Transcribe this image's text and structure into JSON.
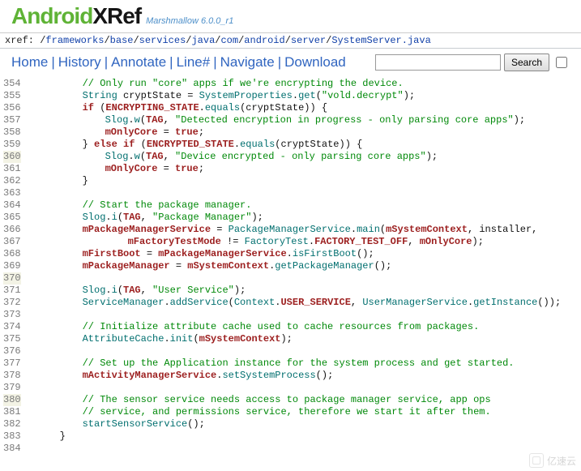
{
  "logo": {
    "a": "Android",
    "x": "XRef"
  },
  "version": "Marshmallow 6.0.0_r1",
  "path": {
    "prefix": "xref: ",
    "segs": [
      "frameworks",
      "base",
      "services",
      "java",
      "com",
      "android",
      "server",
      "SystemServer.java"
    ]
  },
  "nav": {
    "home": "Home",
    "history": "History",
    "annotate": "Annotate",
    "line": "Line#",
    "navigate": "Navigate",
    "download": "Download"
  },
  "search": {
    "placeholder": "",
    "button": "Search"
  },
  "lines": {
    "start": 354,
    "highlight": [
      360,
      370,
      380
    ]
  },
  "code": {
    "l354": "// Only run \"core\" apps if we're encrypting the device.",
    "l355_a": "String",
    "l355_b": " cryptState = ",
    "l355_c": "SystemProperties",
    "l355_d": ".",
    "l355_e": "get",
    "l355_f": "(",
    "l355_g": "\"vold.decrypt\"",
    "l355_h": ");",
    "l356_a": "if",
    "l356_b": " (",
    "l356_c": "ENCRYPTING_STATE",
    "l356_d": ".",
    "l356_e": "equals",
    "l356_f": "(cryptState)) {",
    "l357_a": "Slog",
    "l357_b": ".",
    "l357_c": "w",
    "l357_d": "(",
    "l357_e": "TAG",
    "l357_f": ", ",
    "l357_g": "\"Detected encryption in progress - only parsing core apps\"",
    "l357_h": ");",
    "l358_a": "mOnlyCore",
    "l358_b": " = ",
    "l358_c": "true",
    "l358_d": ";",
    "l359_a": "} ",
    "l359_b": "else if",
    "l359_c": " (",
    "l359_d": "ENCRYPTED_STATE",
    "l359_e": ".",
    "l359_f": "equals",
    "l359_g": "(cryptState)) {",
    "l360_a": "Slog",
    "l360_b": ".",
    "l360_c": "w",
    "l360_d": "(",
    "l360_e": "TAG",
    "l360_f": ", ",
    "l360_g": "\"Device encrypted - only parsing core apps\"",
    "l360_h": ");",
    "l361_a": "mOnlyCore",
    "l361_b": " = ",
    "l361_c": "true",
    "l361_d": ";",
    "l362": "}",
    "l363": "",
    "l364": "// Start the package manager.",
    "l365_a": "Slog",
    "l365_b": ".",
    "l365_c": "i",
    "l365_d": "(",
    "l365_e": "TAG",
    "l365_f": ", ",
    "l365_g": "\"Package Manager\"",
    "l365_h": ");",
    "l366_a": "mPackageManagerService",
    "l366_b": " = ",
    "l366_c": "PackageManagerService",
    "l366_d": ".",
    "l366_e": "main",
    "l366_f": "(",
    "l366_g": "mSystemContext",
    "l366_h": ", installer,",
    "l367_a": "mFactoryTestMode",
    "l367_b": " != ",
    "l367_c": "FactoryTest",
    "l367_d": ".",
    "l367_e": "FACTORY_TEST_OFF",
    "l367_f": ", ",
    "l367_g": "mOnlyCore",
    "l367_h": ");",
    "l368_a": "mFirstBoot",
    "l368_b": " = ",
    "l368_c": "mPackageManagerService",
    "l368_d": ".",
    "l368_e": "isFirstBoot",
    "l368_f": "();",
    "l369_a": "mPackageManager",
    "l369_b": " = ",
    "l369_c": "mSystemContext",
    "l369_d": ".",
    "l369_e": "getPackageManager",
    "l369_f": "();",
    "l370": "",
    "l371_a": "Slog",
    "l371_b": ".",
    "l371_c": "i",
    "l371_d": "(",
    "l371_e": "TAG",
    "l371_f": ", ",
    "l371_g": "\"User Service\"",
    "l371_h": ");",
    "l372_a": "ServiceManager",
    "l372_b": ".",
    "l372_c": "addService",
    "l372_d": "(",
    "l372_e": "Context",
    "l372_f": ".",
    "l372_g": "USER_SERVICE",
    "l372_h": ", ",
    "l372_i": "UserManagerService",
    "l372_j": ".",
    "l372_k": "getInstance",
    "l372_l": "());",
    "l373": "",
    "l374": "// Initialize attribute cache used to cache resources from packages.",
    "l375_a": "AttributeCache",
    "l375_b": ".",
    "l375_c": "init",
    "l375_d": "(",
    "l375_e": "mSystemContext",
    "l375_f": ");",
    "l376": "",
    "l377": "// Set up the Application instance for the system process and get started.",
    "l378_a": "mActivityManagerService",
    "l378_b": ".",
    "l378_c": "setSystemProcess",
    "l378_d": "();",
    "l379": "",
    "l380": "// The sensor service needs access to package manager service, app ops",
    "l381": "// service, and permissions service, therefore we start it after them.",
    "l382_a": "startSensorService",
    "l382_b": "();",
    "l383": "}",
    "l384": ""
  },
  "watermark": "亿速云"
}
